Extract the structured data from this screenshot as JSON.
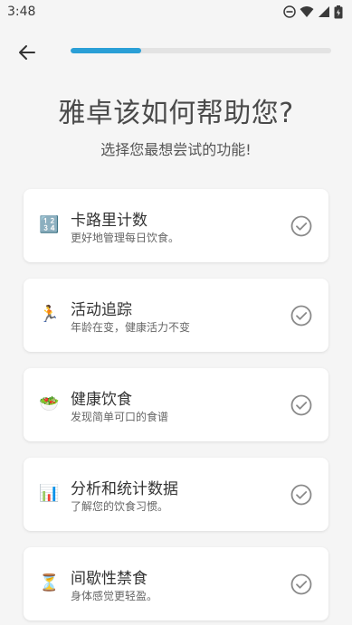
{
  "status": {
    "time": "3:48"
  },
  "progress": {
    "fraction": 0.27
  },
  "header": {
    "title": "雅卓该如何帮助您?",
    "subtitle": "选择您最想尝试的功能!"
  },
  "features": [
    {
      "icon": "abacus-numbers-icon",
      "emoji": "🔢",
      "title": "卡路里计数",
      "subtitle": "更好地管理每日饮食。"
    },
    {
      "icon": "runner-icon",
      "emoji": "🏃",
      "title": "活动追踪",
      "subtitle": "年龄在变，健康活力不变"
    },
    {
      "icon": "salad-bowl-icon",
      "emoji": "🥗",
      "title": "健康饮食",
      "subtitle": "发现简单可口的食谱"
    },
    {
      "icon": "bar-chart-icon",
      "emoji": "📊",
      "title": "分析和统计数据",
      "subtitle": "了解您的饮食习惯。"
    },
    {
      "icon": "hourglass-icon",
      "emoji": "⏳",
      "title": "间歇性禁食",
      "subtitle": "身体感觉更轻盈。"
    }
  ]
}
